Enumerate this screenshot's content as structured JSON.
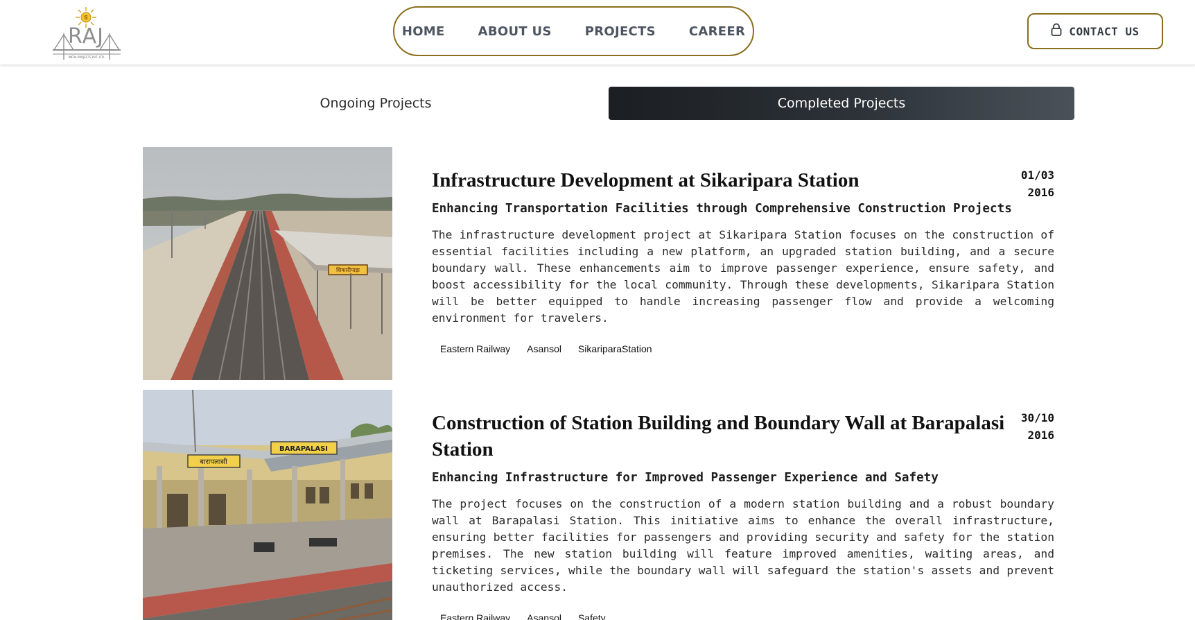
{
  "header": {
    "logo_text": "RAJ",
    "logo_subtext": "INFRA PROJECTS PVT. LTD.",
    "nav": [
      "HOME",
      "ABOUT US",
      "PROJECTS",
      "CAREER"
    ],
    "contact_label": "CONTACT US"
  },
  "tabs": {
    "ongoing": "Ongoing Projects",
    "completed": "Completed Projects",
    "active": "completed"
  },
  "colors": {
    "accent_border": "#8a6d1d",
    "active_tab": "#2d3339"
  },
  "projects": [
    {
      "title": "Infrastructure Development at Sikaripara Station",
      "date_day": "01/03",
      "date_year": "2016",
      "subtitle": "Enhancing Transportation Facilities through Comprehensive Construction Projects",
      "description": "The infrastructure development project at Sikaripara Station focuses on the construction of essential facilities including a new platform, an upgraded station building, and a secure boundary wall. These enhancements aim to improve passenger experience, ensure safety, and boost accessibility for the local community. Through these developments, Sikaripara Station will be better equipped to handle increasing passenger flow and provide a welcoming environment for travelers.",
      "tags": [
        "Eastern Railway",
        "Asansol",
        "SikariparaStation"
      ],
      "image_sign": "शिकारीपाड़ा"
    },
    {
      "title": "Construction of Station Building and Boundary Wall at Barapalasi Station",
      "date_day": "30/10",
      "date_year": "2016",
      "subtitle": "Enhancing Infrastructure for Improved Passenger Experience and Safety",
      "description": "The project focuses on the construction of a modern station building and a robust boundary wall at Barapalasi Station. This initiative aims to enhance the overall infrastructure, ensuring better facilities for passengers and providing security and safety for the station premises. The new station building will feature improved amenities, waiting areas, and ticketing services, while the boundary wall will safeguard the station's assets and prevent unauthorized access.",
      "tags": [
        "Eastern Railway",
        "Asansol",
        "Safety"
      ],
      "image_sign_hindi": "बारापलासी",
      "image_sign_english": "BARAPALASI"
    }
  ]
}
